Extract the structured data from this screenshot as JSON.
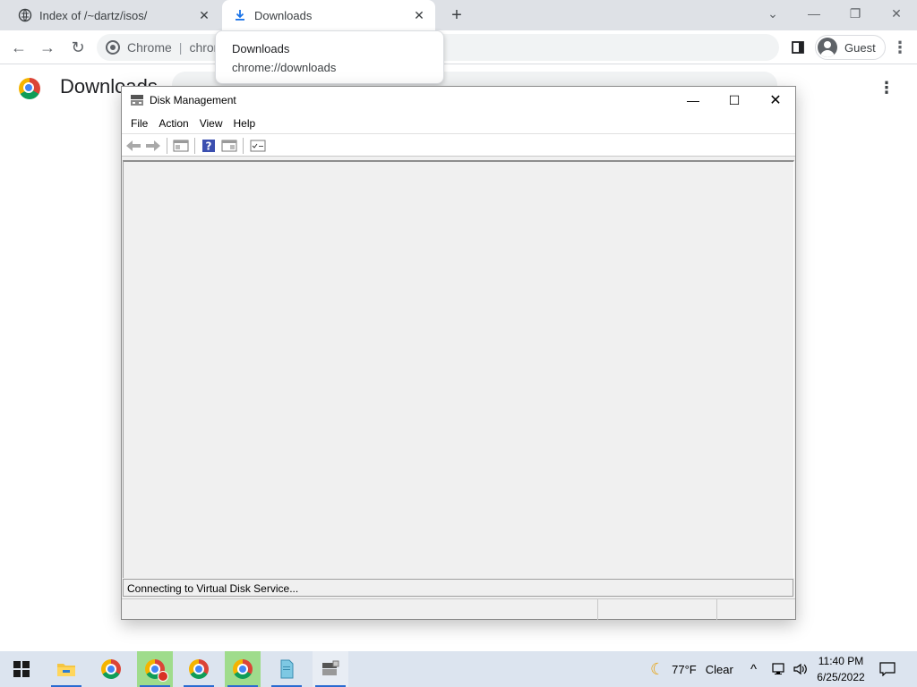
{
  "browser": {
    "tabs": [
      {
        "title": "Index of /~dartz/isos/",
        "icon": "globe-icon",
        "active": false
      },
      {
        "title": "Downloads",
        "icon": "download-icon",
        "active": true
      }
    ],
    "omnibox": {
      "site_label": "Chrome",
      "url_partial": "chrom"
    },
    "profile_label": "Guest",
    "tooltip": {
      "title": "Downloads",
      "url": "chrome://downloads"
    }
  },
  "downloads_page": {
    "title": "Downloads"
  },
  "disk_management": {
    "title": "Disk Management",
    "menu": [
      "File",
      "Action",
      "View",
      "Help"
    ],
    "status_text": "Connecting to Virtual Disk Service..."
  },
  "taskbar": {
    "weather_temp": "77°F",
    "weather_condition": "Clear",
    "time": "11:40 PM",
    "date": "6/25/2022",
    "accent": "#2a6bd1"
  }
}
